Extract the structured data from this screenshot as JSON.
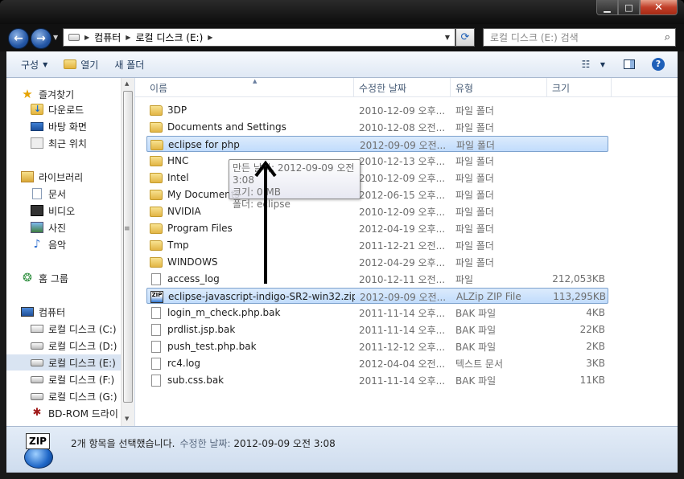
{
  "address": {
    "crumbs": [
      "컴퓨터",
      "로컬 디스크 (E:)"
    ]
  },
  "search": {
    "placeholder": "로컬 디스크 (E:) 검색"
  },
  "toolbar": {
    "organize": "구성",
    "open": "열기",
    "new_folder": "새 폴더"
  },
  "nav": {
    "favorites_label": "즐겨찾기",
    "favorites": [
      "다운로드",
      "바탕 화면",
      "최근 위치"
    ],
    "libraries_label": "라이브러리",
    "libraries": [
      "문서",
      "비디오",
      "사진",
      "음악"
    ],
    "homegroup": "홈 그룹",
    "computer_label": "컴퓨터",
    "drives": [
      "로컬 디스크 (C:)",
      "로컬 디스크 (D:)",
      "로컬 디스크 (E:)",
      "로컬 디스크 (F:)",
      "로컬 디스크 (G:)",
      "BD-ROM 드라이"
    ]
  },
  "columns": {
    "name": "이름",
    "date": "수정한 날짜",
    "type": "유형",
    "size": "크기"
  },
  "files": [
    {
      "name": "3DP",
      "date": "2010-12-09 오후...",
      "type": "파일 폴더",
      "size": "",
      "icon": "folder"
    },
    {
      "name": "Documents and Settings",
      "date": "2010-12-08 오전...",
      "type": "파일 폴더",
      "size": "",
      "icon": "folder"
    },
    {
      "name": "eclipse for php",
      "date": "2012-09-09 오전...",
      "type": "파일 폴더",
      "size": "",
      "icon": "folder",
      "selected": true
    },
    {
      "name": "HNC",
      "date": "2010-12-13 오후...",
      "type": "파일 폴더",
      "size": "",
      "icon": "folder"
    },
    {
      "name": "Intel",
      "date": "2010-12-09 오후...",
      "type": "파일 폴더",
      "size": "",
      "icon": "folder"
    },
    {
      "name": "My Documents",
      "date": "2012-06-15 오후...",
      "type": "파일 폴더",
      "size": "",
      "icon": "folder"
    },
    {
      "name": "NVIDIA",
      "date": "2010-12-09 오후...",
      "type": "파일 폴더",
      "size": "",
      "icon": "folder"
    },
    {
      "name": "Program Files",
      "date": "2012-04-19 오후...",
      "type": "파일 폴더",
      "size": "",
      "icon": "folder"
    },
    {
      "name": "Tmp",
      "date": "2011-12-21 오전...",
      "type": "파일 폴더",
      "size": "",
      "icon": "folder"
    },
    {
      "name": "WINDOWS",
      "date": "2012-04-29 오후...",
      "type": "파일 폴더",
      "size": "",
      "icon": "folder"
    },
    {
      "name": "access_log",
      "date": "2010-12-11 오전...",
      "type": "파일",
      "size": "212,053KB",
      "icon": "file"
    },
    {
      "name": "eclipse-javascript-indigo-SR2-win32.zip",
      "date": "2012-09-09 오전...",
      "type": "ALZip ZIP File",
      "size": "113,295KB",
      "icon": "zip",
      "selected": true
    },
    {
      "name": "login_m_check.php.bak",
      "date": "2011-11-14 오후...",
      "type": "BAK 파일",
      "size": "4KB",
      "icon": "file"
    },
    {
      "name": "prdlist.jsp.bak",
      "date": "2011-11-14 오후...",
      "type": "BAK 파일",
      "size": "22KB",
      "icon": "file"
    },
    {
      "name": "push_test.php.bak",
      "date": "2011-12-12 오후...",
      "type": "BAK 파일",
      "size": "2KB",
      "icon": "file"
    },
    {
      "name": "rc4.log",
      "date": "2012-04-04 오전...",
      "type": "텍스트 문서",
      "size": "3KB",
      "icon": "file"
    },
    {
      "name": "sub.css.bak",
      "date": "2011-11-14 오후...",
      "type": "BAK 파일",
      "size": "11KB",
      "icon": "file"
    }
  ],
  "tooltip": {
    "line1": "만든 날짜: 2012-09-09 오전 3:08",
    "line2": "크기: 0 MB",
    "line3": "폴더: eclipse"
  },
  "details": {
    "count": "2개 항목을 선택했습니다.",
    "date_label": "수정한 날짜:",
    "date_value": "2012-09-09 오전 3:08",
    "icon_text": "ZIP"
  }
}
